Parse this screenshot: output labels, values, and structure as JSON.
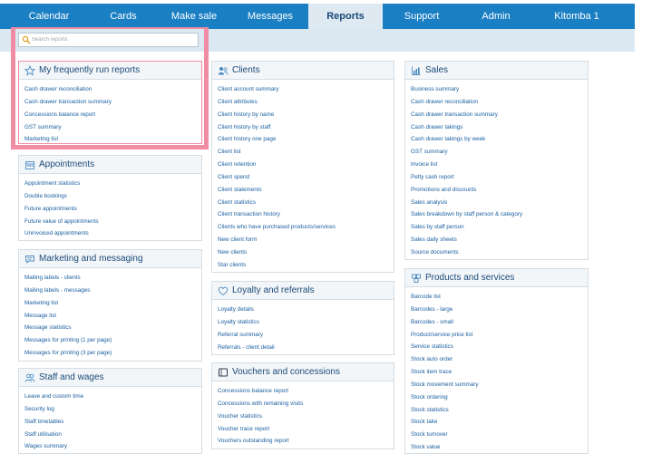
{
  "nav": {
    "items": [
      "Calendar",
      "Cards",
      "Make sale",
      "Messages",
      "Reports",
      "Support",
      "Admin",
      "Kitomba 1"
    ],
    "active": "Reports"
  },
  "search": {
    "placeholder": "Search reports"
  },
  "colors": {
    "nav_bg": "#1a7fc3",
    "link": "#1a5fa0",
    "heading": "#1a4a7a",
    "highlight": "#f08ca3",
    "subbar": "#dbe8f2"
  },
  "sections": {
    "frequent": {
      "icon": "star-icon",
      "title": "My frequently run reports",
      "items": [
        "Cash drawer reconciliation",
        "Cash drawer transaction summary",
        "Concessions balance report",
        "GST summary",
        "Marketing list"
      ]
    },
    "appointments": {
      "icon": "calendar-icon",
      "title": "Appointments",
      "items": [
        "Appointment statistics",
        "Double bookings",
        "Future appointments",
        "Future value of appointments",
        "Uninvoiced appointments"
      ]
    },
    "marketing": {
      "icon": "message-icon",
      "title": "Marketing and messaging",
      "items": [
        "Mailing labels - clients",
        "Mailing labels - messages",
        "Marketing list",
        "Message list",
        "Message statistics",
        "Messages for printing (1 per page)",
        "Messages for printing (3 per page)"
      ]
    },
    "staff": {
      "icon": "staff-icon",
      "title": "Staff and wages",
      "items": [
        "Leave and custom time",
        "Security log",
        "Staff timetables",
        "Staff utilisation",
        "Wages summary"
      ]
    },
    "clients": {
      "icon": "users-icon",
      "title": "Clients",
      "items": [
        "Client account summary",
        "Client attributes",
        "Client history by name",
        "Client history by staff",
        "Client history one page",
        "Client list",
        "Client retention",
        "Client spend",
        "Client statements",
        "Client statistics",
        "Client transaction history",
        "Clients who have purchased products/services",
        "New client form",
        "New clients",
        "Star clients"
      ]
    },
    "loyalty": {
      "icon": "heart-icon",
      "title": "Loyalty and referrals",
      "items": [
        "Loyalty details",
        "Loyalty statistics",
        "Referral summary",
        "Referrals - client detail"
      ]
    },
    "vouchers": {
      "icon": "voucher-icon",
      "title": "Vouchers and concessions",
      "items": [
        "Concessions balance report",
        "Concessions with remaining visits",
        "Voucher statistics",
        "Voucher trace report",
        "Vouchers outstanding report"
      ]
    },
    "sales": {
      "icon": "chart-icon",
      "title": "Sales",
      "items": [
        "Business summary",
        "Cash drawer reconciliation",
        "Cash drawer transaction summary",
        "Cash drawer takings",
        "Cash drawer takings by week",
        "GST summary",
        "Invoice list",
        "Petty cash report",
        "Promotions and discounts",
        "Sales analysis",
        "Sales breakdown by staff person & category",
        "Sales by staff person",
        "Sales daily sheets",
        "Source documents"
      ]
    },
    "products": {
      "icon": "products-icon",
      "title": "Products and services",
      "items": [
        "Barcode list",
        "Barcodes - large",
        "Barcodes - small",
        "Product/service price list",
        "Service statistics",
        "Stock auto order",
        "Stock item trace",
        "Stock movement summary",
        "Stock ordering",
        "Stock statistics",
        "Stock take",
        "Stock turnover",
        "Stock value"
      ]
    }
  }
}
